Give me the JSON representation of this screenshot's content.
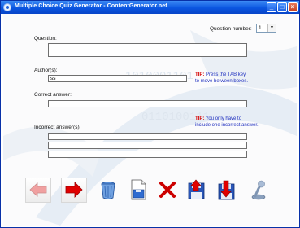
{
  "window": {
    "title": "Multiple Choice Quiz Generator - ContentGenerator.net"
  },
  "question_number": {
    "label": "Question number:",
    "value": "1"
  },
  "question": {
    "label": "Question:",
    "value": ""
  },
  "authors": {
    "label": "Author(s):",
    "value": "ss"
  },
  "tip1": {
    "prefix": "TIP:",
    "line1": "Press the TAB key",
    "line2": "to move between boxes."
  },
  "correct": {
    "label": "Correct answer:",
    "value": ""
  },
  "tip2": {
    "prefix": "TIP:",
    "line1": "You only have to",
    "line2": "include one incorrect answer."
  },
  "incorrect": {
    "label": "Incorrect answer(s):",
    "values": [
      "",
      "",
      ""
    ]
  },
  "toolbar": {
    "icons": [
      "arrow-left-icon",
      "arrow-right-icon",
      "trash-icon",
      "save-doc-icon",
      "delete-x-icon",
      "save-up-icon",
      "save-down-icon",
      "joystick-icon"
    ],
    "accent_red": "#d40000",
    "accent_blue": "#1f2fbf"
  }
}
